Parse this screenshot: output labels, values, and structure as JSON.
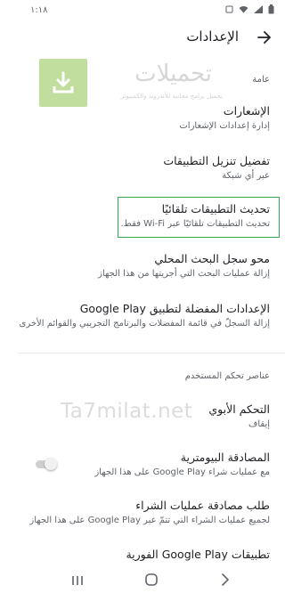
{
  "status_bar": {
    "time": "١:١٨",
    "icons": [
      "battery-icon",
      "signal-icon",
      "wifi-icon",
      "notification-icon"
    ]
  },
  "app_bar": {
    "title": "الإعدادات",
    "back_icon": "arrow-forward-icon"
  },
  "watermark": {
    "brand_name": "تحميلات",
    "tagline": "تحميل برامج مجانية للأندرويد والكمبيوتر",
    "site": "Ta7milat.net",
    "logo_color": "#8bc34a"
  },
  "sections": {
    "general": {
      "header": "عامة",
      "items": [
        {
          "title": "الإشعارات",
          "subtitle": "إدارة إعدادات الإشعارات"
        },
        {
          "title": "تفضيل تنزيل التطبيقات",
          "subtitle": "عبر أي شبكة"
        },
        {
          "title": "تحديث التطبيقات تلقائيًا",
          "subtitle": "تحديث التطبيقات تلقائيًا عبر Wi-Fi فقط."
        },
        {
          "title": "محو سجل البحث المحلي",
          "subtitle": "إزالة عمليات البحث التي أجريتها من هذا الجهاز"
        },
        {
          "title": "الإعدادات المفضلة لتطبيق Google Play",
          "subtitle": "إزالة السجلّ في قائمة المفضلات والبرنامج التجريبي والقوائم الأخرى"
        }
      ]
    },
    "user_controls": {
      "header": "عناصر تحكم المستخدم",
      "items": [
        {
          "title": "التحكم الأبوي",
          "subtitle": "إيقاف"
        },
        {
          "title": "المصادقة البيومترية",
          "subtitle": "مع عمليات شراء Google Play على هذا الجهاز",
          "toggle_on": false
        },
        {
          "title": "طلب مصادقة عمليات الشراء",
          "subtitle": "لجميع عمليات الشراء التي تتمّ عبر Google Play على هذا الجهاز"
        },
        {
          "title": "تطبيقات Google Play الفورية"
        }
      ]
    }
  },
  "colors": {
    "highlight_border": "#34a853",
    "text_primary": "#202124",
    "text_secondary": "#5f6368"
  },
  "nav_bar": {
    "buttons": [
      "recents-icon",
      "home-icon",
      "back-icon"
    ]
  }
}
